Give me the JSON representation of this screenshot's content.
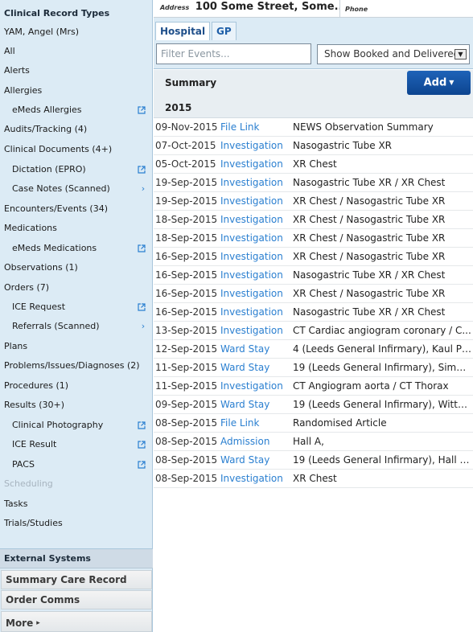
{
  "sidebar": {
    "header": "Clinical Record Types",
    "items": [
      {
        "label": "YAM, Angel (Mrs)"
      },
      {
        "label": "All"
      },
      {
        "label": "Alerts"
      },
      {
        "label": "Allergies"
      },
      {
        "label": "eMeds Allergies",
        "icon": "external-link-icon"
      },
      {
        "label": "Audits/Tracking (4)"
      },
      {
        "label": "Clinical Documents (4+)"
      },
      {
        "label": "Dictation (EPRO)",
        "icon": "external-link-icon"
      },
      {
        "label": "Case Notes (Scanned)",
        "icon": "chevron-right-icon"
      },
      {
        "label": "Encounters/Events (34)"
      },
      {
        "label": "Medications"
      },
      {
        "label": "eMeds Medications",
        "icon": "external-link-icon"
      },
      {
        "label": "Observations (1)"
      },
      {
        "label": "Orders (7)"
      },
      {
        "label": "ICE Request",
        "icon": "external-link-icon"
      },
      {
        "label": "Referrals (Scanned)",
        "icon": "chevron-right-icon"
      },
      {
        "label": "Plans"
      },
      {
        "label": "Problems/Issues/Diagnoses (2)"
      },
      {
        "label": "Procedures (1)"
      },
      {
        "label": "Results (30+)"
      },
      {
        "label": "Clinical Photography",
        "icon": "external-link-icon"
      },
      {
        "label": "ICE Result",
        "icon": "external-link-icon"
      },
      {
        "label": "PACS",
        "icon": "external-link-icon"
      },
      {
        "label": "Scheduling"
      },
      {
        "label": "Tasks"
      },
      {
        "label": "Trials/Studies"
      }
    ],
    "external_header": "External Systems",
    "external_buttons": [
      "Summary Care Record",
      "Order Comms",
      "More"
    ]
  },
  "patient_bar": {
    "address_label": "Address",
    "address_value": "100 Some Street, Some...",
    "phone_label": "Phone"
  },
  "tabs": [
    "Hospital",
    "GP"
  ],
  "filter": {
    "placeholder": "Filter Events...",
    "show_value": "Show Booked and Delivered"
  },
  "summary": {
    "title": "Summary",
    "add_label": "Add"
  },
  "year": "2015",
  "events": [
    {
      "date": "09-Nov-2015",
      "type": "File Link",
      "desc": "NEWS Observation Summary"
    },
    {
      "date": "07-Oct-2015",
      "type": "Investigation",
      "desc": "Nasogastric Tube XR"
    },
    {
      "date": "05-Oct-2015",
      "type": "Investigation",
      "desc": "XR Chest"
    },
    {
      "date": "19-Sep-2015",
      "type": "Investigation",
      "desc": "Nasogastric Tube XR / XR Chest"
    },
    {
      "date": "19-Sep-2015",
      "type": "Investigation",
      "desc": "XR Chest / Nasogastric Tube XR"
    },
    {
      "date": "18-Sep-2015",
      "type": "Investigation",
      "desc": "XR Chest / Nasogastric Tube XR"
    },
    {
      "date": "18-Sep-2015",
      "type": "Investigation",
      "desc": "XR Chest / Nasogastric Tube XR"
    },
    {
      "date": "16-Sep-2015",
      "type": "Investigation",
      "desc": "XR Chest / Nasogastric Tube XR"
    },
    {
      "date": "16-Sep-2015",
      "type": "Investigation",
      "desc": "Nasogastric Tube XR / XR Chest"
    },
    {
      "date": "16-Sep-2015",
      "type": "Investigation",
      "desc": "XR Chest / Nasogastric Tube XR"
    },
    {
      "date": "16-Sep-2015",
      "type": "Investigation",
      "desc": "Nasogastric Tube XR / XR Chest"
    },
    {
      "date": "13-Sep-2015",
      "type": "Investigation",
      "desc": "CT Cardiac angiogram coronary / C..."
    },
    {
      "date": "12-Sep-2015",
      "type": "Ward Stay",
      "desc": "4 (Leeds General Infirmary), Kaul P,..."
    },
    {
      "date": "11-Sep-2015",
      "type": "Ward Stay",
      "desc": "19 (Leeds General Infirmary), Simm..."
    },
    {
      "date": "11-Sep-2015",
      "type": "Investigation",
      "desc": "CT Angiogram aorta / CT Thorax"
    },
    {
      "date": "09-Sep-2015",
      "type": "Ward Stay",
      "desc": "19 (Leeds General Infirmary), Witte ..."
    },
    {
      "date": "08-Sep-2015",
      "type": "File Link",
      "desc": "Randomised Article"
    },
    {
      "date": "08-Sep-2015",
      "type": "Admission",
      "desc": "Hall A,"
    },
    {
      "date": "08-Sep-2015",
      "type": "Ward Stay",
      "desc": "19 (Leeds General Infirmary), Hall A..."
    },
    {
      "date": "08-Sep-2015",
      "type": "Investigation",
      "desc": "XR Chest"
    }
  ]
}
